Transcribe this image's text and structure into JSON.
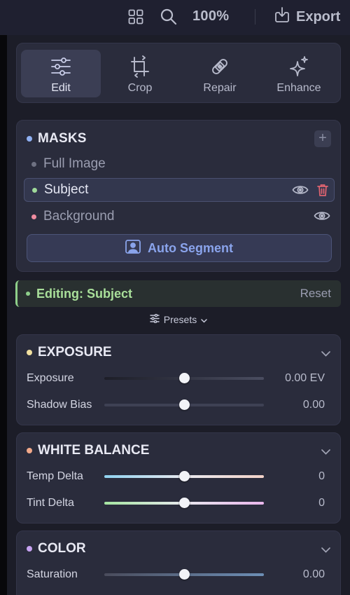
{
  "topbar": {
    "zoom": "100%",
    "export_label": "Export"
  },
  "tools": [
    {
      "label": "Edit",
      "active": true,
      "icon": "sliders-icon"
    },
    {
      "label": "Crop",
      "active": false,
      "icon": "crop-icon"
    },
    {
      "label": "Repair",
      "active": false,
      "icon": "bandage-icon"
    },
    {
      "label": "Enhance",
      "active": false,
      "icon": "sparkles-icon"
    }
  ],
  "masks": {
    "title": "MASKS",
    "items": [
      {
        "label": "Full Image",
        "color": "#6e7182"
      },
      {
        "label": "Subject",
        "color": "#9fd99a"
      },
      {
        "label": "Background",
        "color": "#f08ca0"
      }
    ],
    "auto_segment_label": "Auto Segment"
  },
  "editing": {
    "text": "Editing: Subject",
    "reset_label": "Reset"
  },
  "presets_label": "Presets",
  "exposure": {
    "title": "EXPOSURE",
    "sliders": [
      {
        "label": "Exposure",
        "value": "0.00 EV",
        "level": 0.5
      },
      {
        "label": "Shadow Bias",
        "value": "0.00",
        "level": 0.5
      }
    ]
  },
  "white_balance": {
    "title": "WHITE BALANCE",
    "sliders": [
      {
        "label": "Temp Delta",
        "value": "0",
        "level": 0.5
      },
      {
        "label": "Tint Delta",
        "value": "0",
        "level": 0.5
      }
    ]
  },
  "color": {
    "title": "COLOR",
    "sliders": [
      {
        "label": "Saturation",
        "value": "0.00",
        "level": 0.5
      }
    ]
  },
  "colors": {
    "accent": "#8aa4ec",
    "masks_dot": "#8fb0f2",
    "exposure_dot": "#f1e0a0",
    "wb_dot": "#f2a98a",
    "color_dot": "#c7a3f2"
  }
}
